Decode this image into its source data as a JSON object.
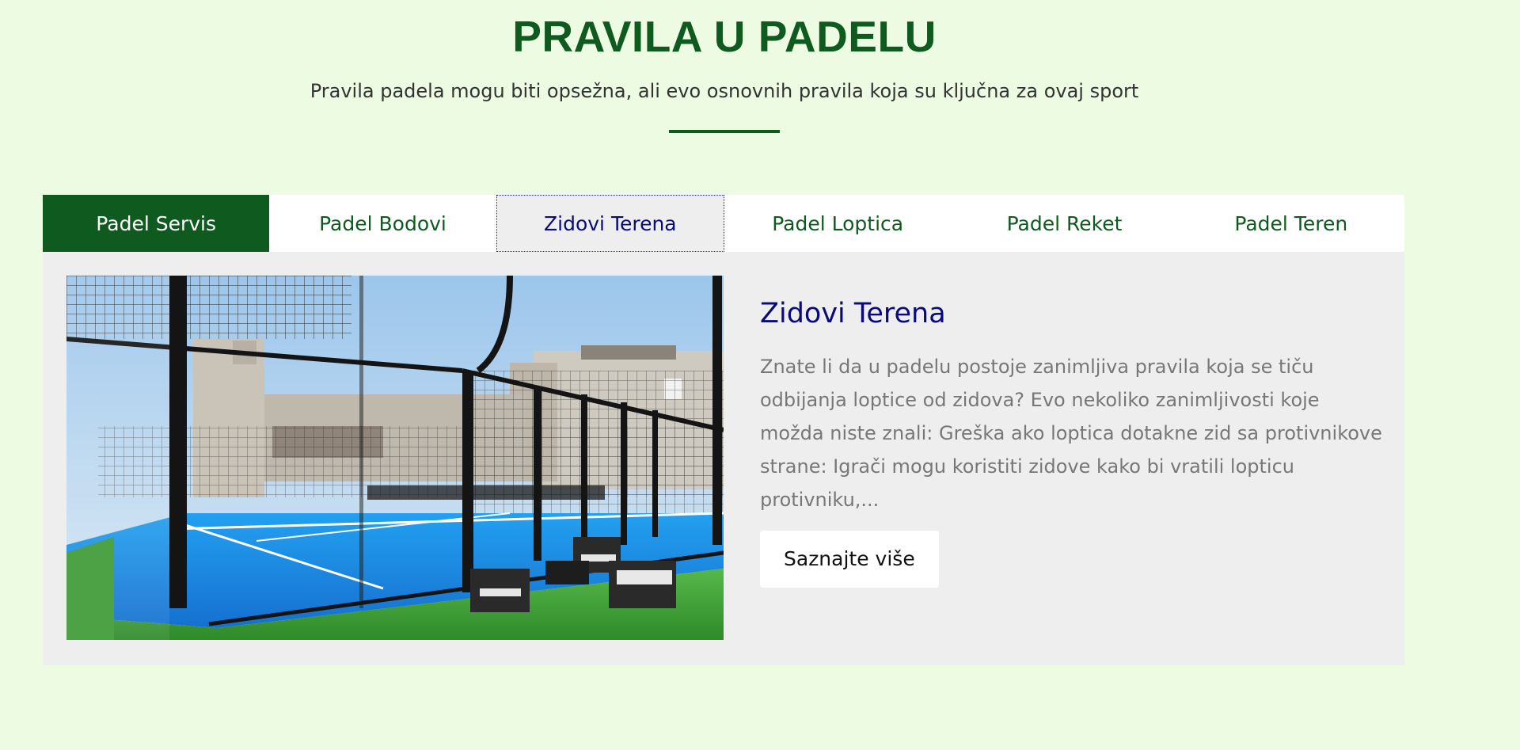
{
  "header": {
    "title": "PRAVILA U PADELU",
    "subtitle": "Pravila padela mogu biti opsežna, ali evo osnovnih pravila koja su ključna za ovaj sport"
  },
  "tabs": [
    {
      "label": "Padel Servis"
    },
    {
      "label": "Padel Bodovi"
    },
    {
      "label": "Zidovi Terena"
    },
    {
      "label": "Padel Loptica"
    },
    {
      "label": "Padel Reket"
    },
    {
      "label": "Padel Teren"
    }
  ],
  "content": {
    "heading": "Zidovi Terena",
    "body": "Znate li da u padelu postoje zanimljiva pravila koja se tiču odbijanja loptice od zidova? Evo nekoliko zanimljivosti koje možda niste znali: Greška ako loptica dotakne zid sa protivnikove strane: Igrači mogu koristiti zidove kako bi vratili lopticu protivniku,...",
    "button_label": "Saznajte više"
  },
  "colors": {
    "page_background": "#eefbe3",
    "brand_green": "#0f5a1f",
    "heading_navy": "#0a0a7a",
    "panel_gray": "#eeeeee",
    "court_blue": "#1d8fe6",
    "grass_green": "#3fa33a"
  }
}
